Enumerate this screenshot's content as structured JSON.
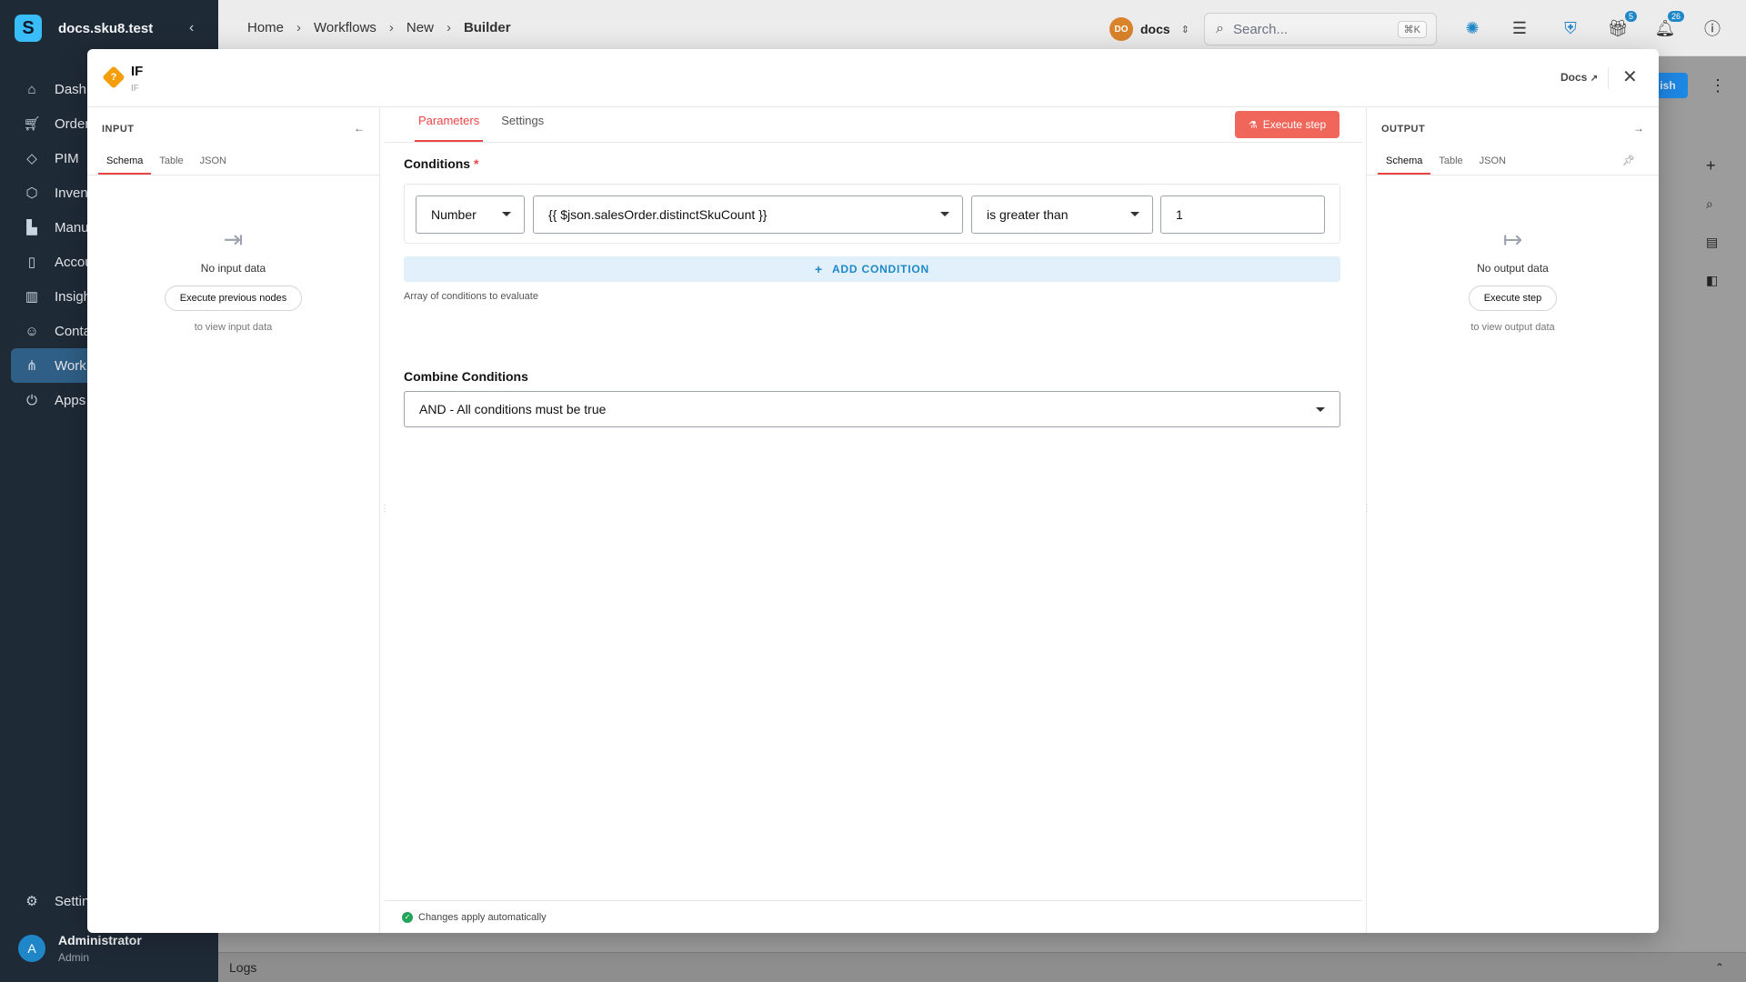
{
  "sidebar": {
    "brand": "docs.sku8.test",
    "logo_letter": "S",
    "items": [
      {
        "label": "Dashb",
        "icon": "home-icon"
      },
      {
        "label": "Orders",
        "icon": "cart-icon"
      },
      {
        "label": "PIM",
        "icon": "tag-icon"
      },
      {
        "label": "Invent",
        "icon": "box-icon"
      },
      {
        "label": "Manuf",
        "icon": "factory-icon"
      },
      {
        "label": "Accou",
        "icon": "book-icon"
      },
      {
        "label": "Insigh",
        "icon": "chart-icon"
      },
      {
        "label": "Conta",
        "icon": "contacts-icon"
      },
      {
        "label": "Work",
        "icon": "workflow-icon",
        "active": true
      },
      {
        "label": "Apps",
        "icon": "plug-icon"
      }
    ],
    "settings_label": "Settin",
    "user": {
      "initial": "A",
      "name": "Administrator",
      "role": "Admin"
    }
  },
  "topbar": {
    "breadcrumbs": [
      "Home",
      "Workflows",
      "New",
      "Builder"
    ],
    "workspace": {
      "initials": "DO",
      "name": "docs"
    },
    "search": {
      "placeholder": "Search...",
      "shortcut": "⌘K"
    },
    "gift_badge": "5",
    "notification_badge": "26"
  },
  "canvas": {
    "publish_label": "ish",
    "logs_label": "Logs"
  },
  "modal": {
    "title": "IF",
    "subtitle": "IF",
    "docs_label": "Docs",
    "input_panel": {
      "heading": "INPUT",
      "tabs": [
        "Schema",
        "Table",
        "JSON"
      ],
      "empty_text": "No input data",
      "button": "Execute previous nodes",
      "hint": "to view input data"
    },
    "output_panel": {
      "heading": "OUTPUT",
      "tabs": [
        "Schema",
        "Table",
        "JSON"
      ],
      "empty_text": "No output data",
      "button": "Execute step",
      "hint": "to view output data"
    },
    "main": {
      "tabs": [
        "Parameters",
        "Settings"
      ],
      "execute_label": "Execute step",
      "conditions_label": "Conditions",
      "condition": {
        "type": "Number",
        "value1": "{{ $json.salesOrder.distinctSkuCount }}",
        "operation": "is greater than",
        "value2": "1"
      },
      "add_condition_label": "ADD CONDITION",
      "helper_text": "Array of conditions to evaluate",
      "combine_label": "Combine Conditions",
      "combine_value": "AND - All conditions must be true",
      "footer_text": "Changes apply automatically"
    }
  }
}
